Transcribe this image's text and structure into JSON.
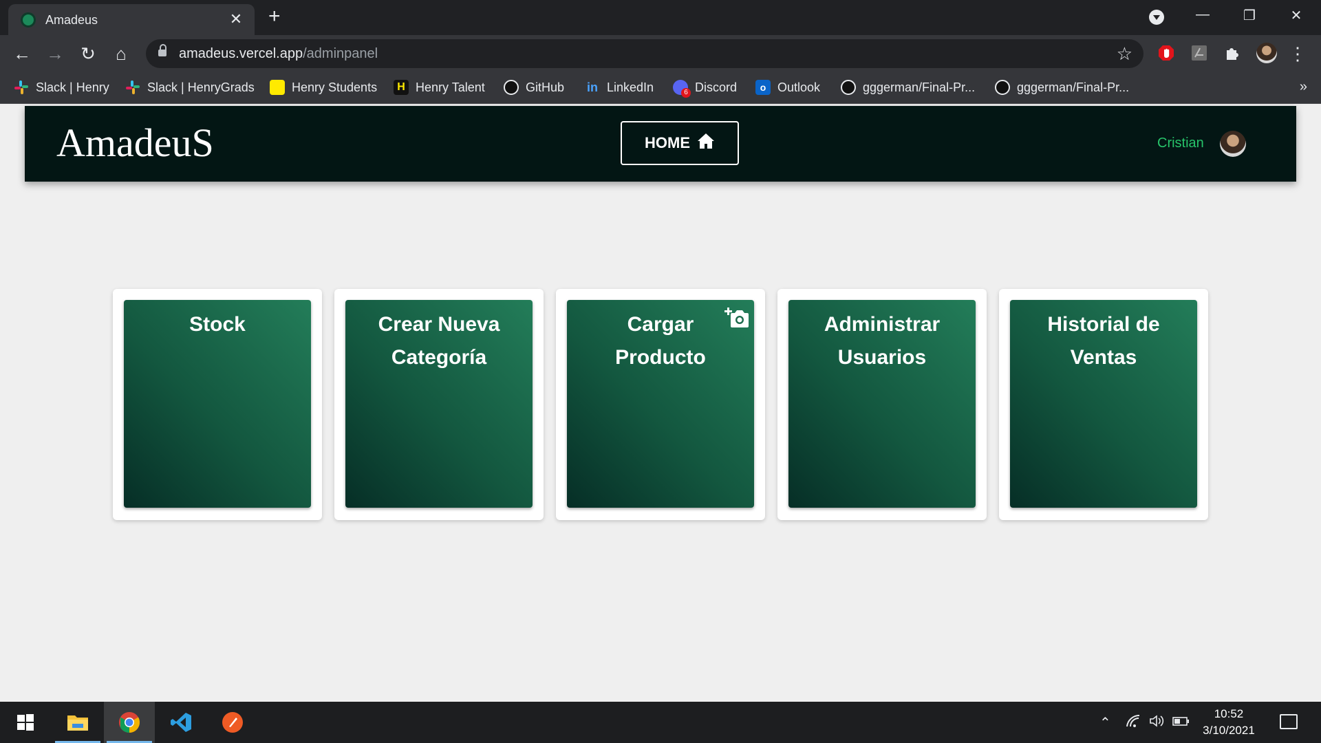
{
  "browser": {
    "tab_title": "Amadeus",
    "tab_close": "✕",
    "new_tab": "+",
    "url_host": "amadeus.vercel.app",
    "url_path": "/adminpanel",
    "bookmarks": [
      {
        "label": "Slack | Henry",
        "icon": "slack-icon"
      },
      {
        "label": "Slack | HenryGrads",
        "icon": "slack-icon"
      },
      {
        "label": "Henry Students",
        "icon": "henry-icon"
      },
      {
        "label": "Henry Talent",
        "icon": "henry-talent-icon"
      },
      {
        "label": "GitHub",
        "icon": "github-icon"
      },
      {
        "label": "LinkedIn",
        "icon": "linkedin-icon"
      },
      {
        "label": "Discord",
        "icon": "discord-icon"
      },
      {
        "label": "Outlook",
        "icon": "outlook-icon"
      },
      {
        "label": "gggerman/Final-Pr...",
        "icon": "github-icon"
      },
      {
        "label": "gggerman/Final-Pr...",
        "icon": "github-icon"
      }
    ],
    "bookmarks_more": "»",
    "discord_badge": "6"
  },
  "site": {
    "brand": "AmadeuS",
    "home_label": "HOME",
    "user_name": "Cristian"
  },
  "cards": [
    {
      "title": "Stock"
    },
    {
      "title": "Crear Nueva Categoría"
    },
    {
      "title": "Cargar Producto",
      "icon": "add-photo-icon"
    },
    {
      "title": "Administrar Usuarios"
    },
    {
      "title": "Historial de Ventas"
    }
  ],
  "taskbar": {
    "time": "10:52",
    "date": "3/10/2021"
  },
  "colors": {
    "nav_bg": "#031614",
    "user_name": "#27c46a",
    "card_gradient_dark": "#062e26",
    "card_gradient_light": "#237d59",
    "page_bg": "#efefef"
  }
}
